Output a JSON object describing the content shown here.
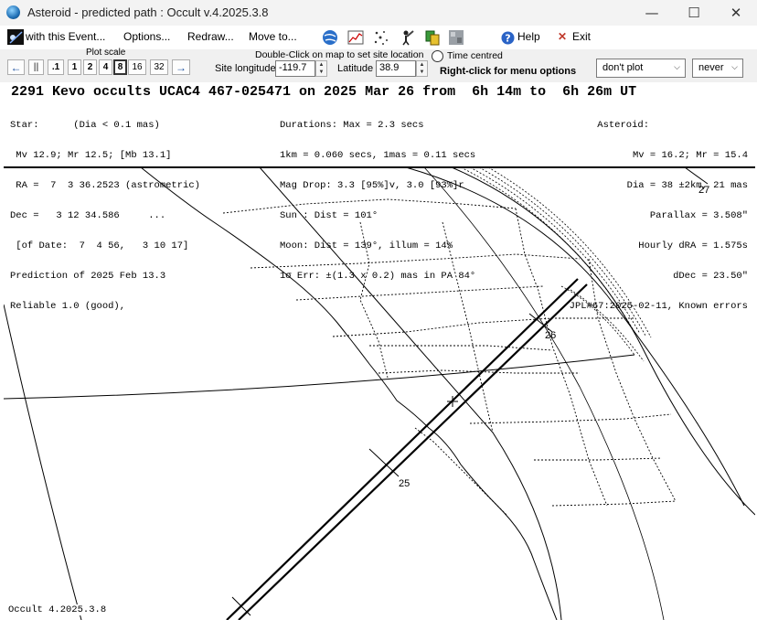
{
  "window": {
    "title": "Asteroid - predicted path : Occult v.4.2025.3.8",
    "minimize": "—",
    "maximize": "☐",
    "close": "✕"
  },
  "menu": {
    "event": "with this Event...",
    "options": "Options...",
    "redraw": "Redraw...",
    "moveto": "Move to...",
    "help": "Help",
    "exit": "Exit"
  },
  "toolbar": {
    "plot_scale_label": "Plot scale",
    "nav_left": "←",
    "pause": "||",
    "scales": [
      ".1",
      "1",
      "2",
      "4",
      "8",
      "16",
      "32"
    ],
    "selected_scale": "8",
    "nav_right": "→",
    "hint": "Double-Click on map to set site location",
    "site_longitude_label": "Site longitude",
    "site_longitude_value": "-119.7",
    "latitude_label": "Latitude",
    "latitude_value": "38.9",
    "time_centred_label": "Time centred",
    "right_click_hint": "Right-click for menu options",
    "plot_dropdown": "don't plot",
    "never_dropdown": "never"
  },
  "event": {
    "headline": "2291 Kevo occults UCAC4 467-025471 on 2025 Mar 26 from  6h 14m to  6h 26m UT",
    "left": [
      "Star:      (Dia < 0.1 mas)",
      " Mv 12.9; Mr 12.5; [Mb 13.1]",
      " RA =  7  3 36.2523 (astrometric)",
      "Dec =   3 12 34.586     ...",
      " [of Date:  7  4 56,   3 10 17]",
      "Prediction of 2025 Feb 13.3",
      "Reliable 1.0 (good),"
    ],
    "middle": [
      "Durations: Max = 2.3 secs",
      "1km = 0.060 secs, 1mas = 0.11 secs",
      "Mag Drop: 3.3 [95%]v, 3.0 [93%]r",
      "Sun : Dist = 101°",
      "Moon: Dist = 139°, illum = 14%",
      "1σ Err: ±(1.3 x 0.2) mas in PA 84°"
    ],
    "right": [
      "Asteroid:",
      "Mv = 16.2; Mr = 15.4",
      "Dia = 38 ±2km, 21 mas",
      "Parallax = 3.508\"",
      "Hourly dRA = 1.575s",
      "dDec = 23.50\"",
      "JPL#67:2025-02-11, Known errors"
    ]
  },
  "map": {
    "time_labels": [
      "27",
      "26",
      "25"
    ]
  },
  "footer": {
    "version": "Occult 4.2025.3.8"
  }
}
